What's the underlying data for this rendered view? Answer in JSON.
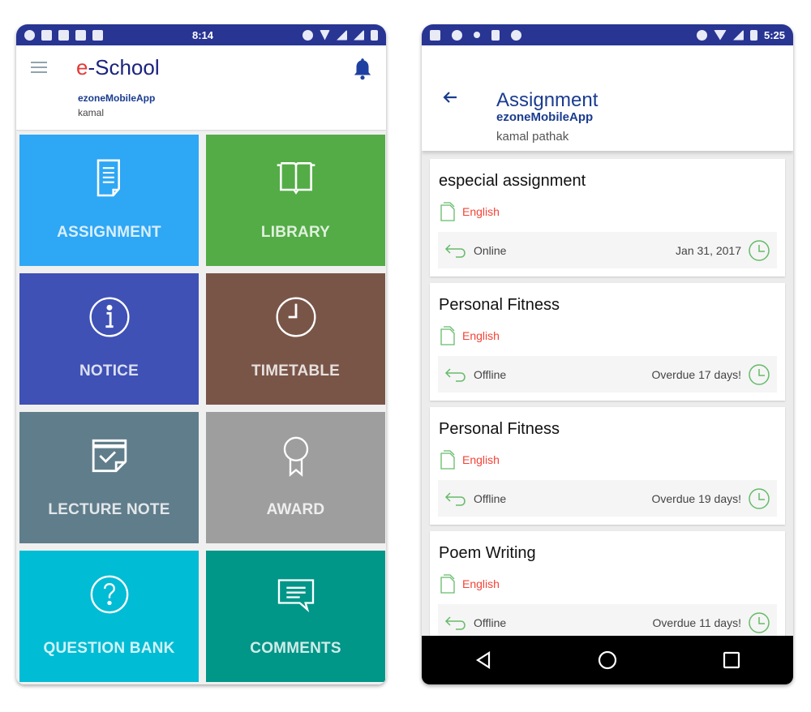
{
  "left_screen": {
    "status_bar": {
      "time": "8:14"
    },
    "header": {
      "logo_prefix": "e",
      "logo_suffix": "-School",
      "org": "ezoneMobileApp",
      "user": "kamal"
    },
    "tiles": [
      {
        "label": "ASSIGNMENT",
        "icon": "document-icon",
        "color": "#2ea7f5"
      },
      {
        "label": "LIBRARY",
        "icon": "book-icon",
        "color": "#53ac46"
      },
      {
        "label": "NOTICE",
        "icon": "info-icon",
        "color": "#3f51b5"
      },
      {
        "label": "TIMETABLE",
        "icon": "clock-icon",
        "color": "#795548"
      },
      {
        "label": "LECTURE NOTE",
        "icon": "note-check-icon",
        "color": "#607d8b"
      },
      {
        "label": "AWARD",
        "icon": "award-icon",
        "color": "#9e9e9e"
      },
      {
        "label": "QUESTION BANK",
        "icon": "question-icon",
        "color": "#00bcd4"
      },
      {
        "label": "COMMENTS",
        "icon": "comment-icon",
        "color": "#009688"
      }
    ]
  },
  "right_screen": {
    "status_bar": {
      "time": "5:25"
    },
    "header": {
      "title": "Assignment",
      "org": "ezoneMobileApp",
      "user": "kamal pathak"
    },
    "assignments": [
      {
        "title": "especial assignment",
        "subject": "English",
        "mode": "Online",
        "due": "Jan 31, 2017"
      },
      {
        "title": "Personal Fitness",
        "subject": "English",
        "mode": "Offline",
        "due": "Overdue 17 days!"
      },
      {
        "title": "Personal Fitness",
        "subject": "English",
        "mode": "Offline",
        "due": "Overdue 19 days!"
      },
      {
        "title": "Poem Writing",
        "subject": "English",
        "mode": "Offline",
        "due": "Overdue 11 days!"
      }
    ]
  }
}
